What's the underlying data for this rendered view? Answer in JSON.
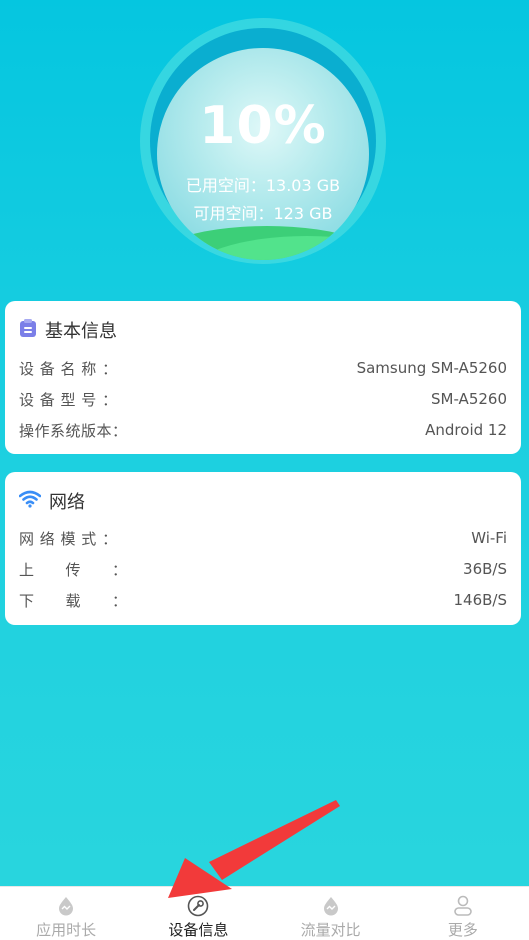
{
  "storage": {
    "percent": "10%",
    "used": "已用空间：13.03 GB",
    "available": "可用空间：123 GB"
  },
  "basic_info": {
    "title": "基本信息",
    "rows": [
      {
        "key": "设 备 名 称 ：",
        "value": "Samsung SM-A5260"
      },
      {
        "key": "设 备 型 号 ：",
        "value": "SM-A5260"
      },
      {
        "key": "操作系统版本：",
        "value": "Android 12"
      }
    ]
  },
  "network": {
    "title": "网络",
    "rows": [
      {
        "key": "网 络 模 式 ：",
        "value": "Wi-Fi"
      },
      {
        "key": "上　　传　　：",
        "value": "36B/S"
      },
      {
        "key": "下　　载　　：",
        "value": "146B/S"
      }
    ]
  },
  "nav": {
    "items": [
      {
        "label": "应用时长",
        "icon": "drop-icon",
        "active": false
      },
      {
        "label": "设备信息",
        "icon": "wrench-icon",
        "active": true
      },
      {
        "label": "流量对比",
        "icon": "drop-icon",
        "active": false
      },
      {
        "label": "更多",
        "icon": "person-icon",
        "active": false
      }
    ]
  },
  "colors": {
    "background": "#1ccfe0",
    "ring": "#0aaed0",
    "accent_purple": "#7b7fe8",
    "wifi_blue": "#3a8ef6",
    "arrow_red": "#f23a3a"
  }
}
